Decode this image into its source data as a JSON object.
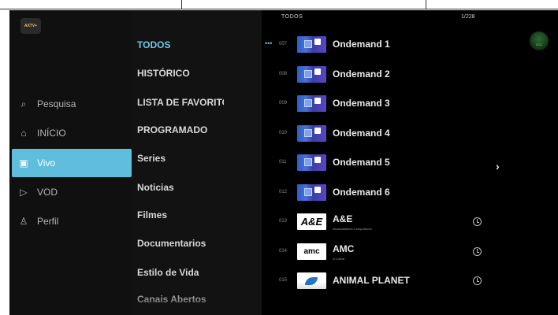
{
  "brand": {
    "logo_text": "AXTV+"
  },
  "nav": {
    "items": [
      {
        "label": "Pesquisa",
        "icon": "search-icon",
        "glyph": "⌕",
        "active": false
      },
      {
        "label": "INÍCIO",
        "icon": "home-icon",
        "glyph": "⌂",
        "active": false
      },
      {
        "label": "Vivo",
        "icon": "tv-icon",
        "glyph": "▣",
        "active": true
      },
      {
        "label": "VOD",
        "icon": "play-icon",
        "glyph": "▷",
        "active": false
      },
      {
        "label": "Perfil",
        "icon": "user-icon",
        "glyph": "♙",
        "active": false
      }
    ]
  },
  "categories": [
    {
      "label": "TODOS",
      "active": true
    },
    {
      "label": "HISTÓRICO",
      "active": false
    },
    {
      "label": "LISTA DE FAVORITOS",
      "active": false
    },
    {
      "label": "PROGRAMADO",
      "active": false
    },
    {
      "label": "Series",
      "active": false
    },
    {
      "label": "Noticias",
      "active": false
    },
    {
      "label": "Filmes",
      "active": false
    },
    {
      "label": "Documentarios",
      "active": false
    },
    {
      "label": "Estilo de Vida",
      "active": false
    },
    {
      "label": "Canais Abertos",
      "active": false
    }
  ],
  "list": {
    "header_title": "TODOS",
    "header_count": "1/228",
    "badge_text": "GCL",
    "rows": [
      {
        "num": "007",
        "title": "Ondemand 1",
        "sub": "",
        "logo": "ondemand",
        "focused": true,
        "clock": false
      },
      {
        "num": "008",
        "title": "Ondemand 2",
        "sub": "",
        "logo": "ondemand",
        "focused": false,
        "clock": false
      },
      {
        "num": "009",
        "title": "Ondemand 3",
        "sub": "",
        "logo": "ondemand",
        "focused": false,
        "clock": false
      },
      {
        "num": "010",
        "title": "Ondemand 4",
        "sub": "",
        "logo": "ondemand",
        "focused": false,
        "clock": false
      },
      {
        "num": "011",
        "title": "Ondemand 5",
        "sub": "",
        "logo": "ondemand",
        "focused": false,
        "clock": false
      },
      {
        "num": "012",
        "title": "Ondemand 6",
        "sub": "",
        "logo": "ondemand",
        "focused": false,
        "clock": false
      },
      {
        "num": "013",
        "title": "A&E",
        "sub": "Acumuladores Compulsivos",
        "logo": "ae",
        "logo_text": "A&E",
        "focused": false,
        "clock": true
      },
      {
        "num": "014",
        "title": "AMC",
        "sub": "A Colina",
        "logo": "amc",
        "logo_text": "amc",
        "focused": false,
        "clock": true
      },
      {
        "num": "015",
        "title": "ANIMAL PLANET",
        "sub": "",
        "logo": "animalplanet",
        "focused": false,
        "clock": true
      }
    ]
  }
}
